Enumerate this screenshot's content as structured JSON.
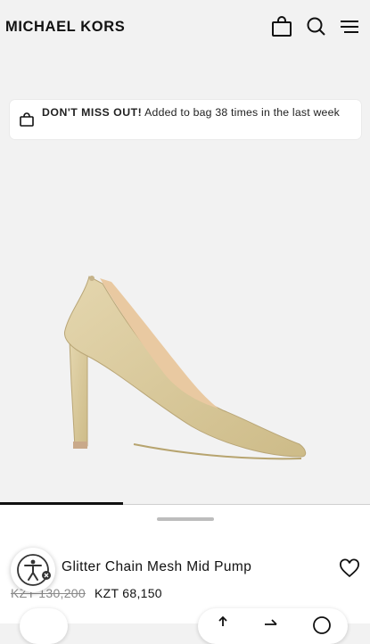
{
  "header": {
    "brand": "MICHAEL KORS",
    "icons": [
      "shopping-bag-icon",
      "search-icon",
      "hamburger-menu-icon"
    ]
  },
  "promo": {
    "headline": "DON'T MISS OUT!",
    "message": " Added to bag 38 times in the last week",
    "icon": "shopping-bag-icon"
  },
  "product": {
    "name": "Glitter Chain Mesh Mid Pump",
    "price_original": "KZT 130,200",
    "price_sale": "KZT 68,150"
  },
  "image_gallery": {
    "active_index": 0,
    "total": 3
  },
  "colors": {
    "background": "#f2f2f2",
    "card": "#ffffff",
    "text": "#111111",
    "muted": "#8a8a8a",
    "shoe": "#d8c89c"
  }
}
